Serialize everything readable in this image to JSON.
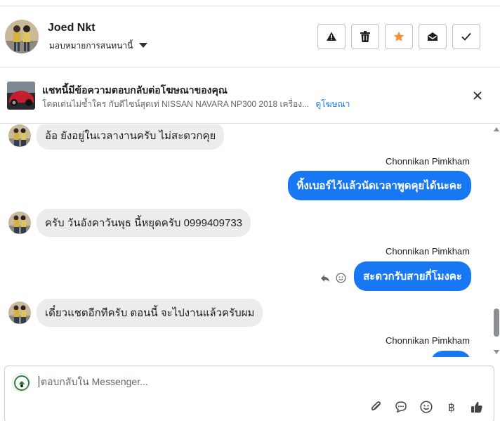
{
  "header": {
    "contact_name": "Joed Nkt",
    "assign_label": "มอบหมายการสนทนานี้",
    "actions": [
      {
        "icon": "alert-icon"
      },
      {
        "icon": "trash-icon"
      },
      {
        "icon": "star-icon",
        "color": "#f7923b"
      },
      {
        "icon": "mark-unread-icon"
      },
      {
        "icon": "checkmark-icon"
      }
    ]
  },
  "ad_banner": {
    "title": "แชทนี้มีข้อความตอบกลับต่อโฆษณาของคุณ",
    "subtitle": "โดดเด่นไม่ซ้ำใคร กับดีไซน์สุดเท่ NISSAN NAVARA NP300 2018 เครื่อง...",
    "link_label": "ดูโฆษณา"
  },
  "messages": [
    {
      "direction": "in",
      "text": "อ้อ ยังอยู่ในเวลางานครับ ไม่สะดวกคุย"
    },
    {
      "direction": "out",
      "sender": "Chonnikan Pimkham",
      "text": "ทิ้งเบอร์ไว้แล้วนัดเวลาพูดคุยได้นะคะ"
    },
    {
      "direction": "in",
      "text": "ครับ วันอังคาวันพุธ นี้หยุดครับ 0999409733"
    },
    {
      "direction": "out",
      "sender": "Chonnikan Pimkham",
      "text": "สะดวกรับสายกี่โมงคะ"
    },
    {
      "direction": "in",
      "text": "เดี๋ยวแชตอีกทีครับ ตอนนี้ จะไปงานแล้วครับผม"
    },
    {
      "direction": "out",
      "sender": "Chonnikan Pimkham",
      "text": ""
    }
  ],
  "composer": {
    "placeholder": "ตอบกลับใน Messenger...",
    "tools": [
      "paperclip-icon",
      "chat-bubble-icon",
      "emoji-icon",
      "baht-icon",
      "thumbs-up-icon"
    ],
    "baht_symbol": "฿"
  },
  "colors": {
    "accent": "#1877f2",
    "incoming_bubble": "#ececec",
    "star": "#f7923b"
  }
}
